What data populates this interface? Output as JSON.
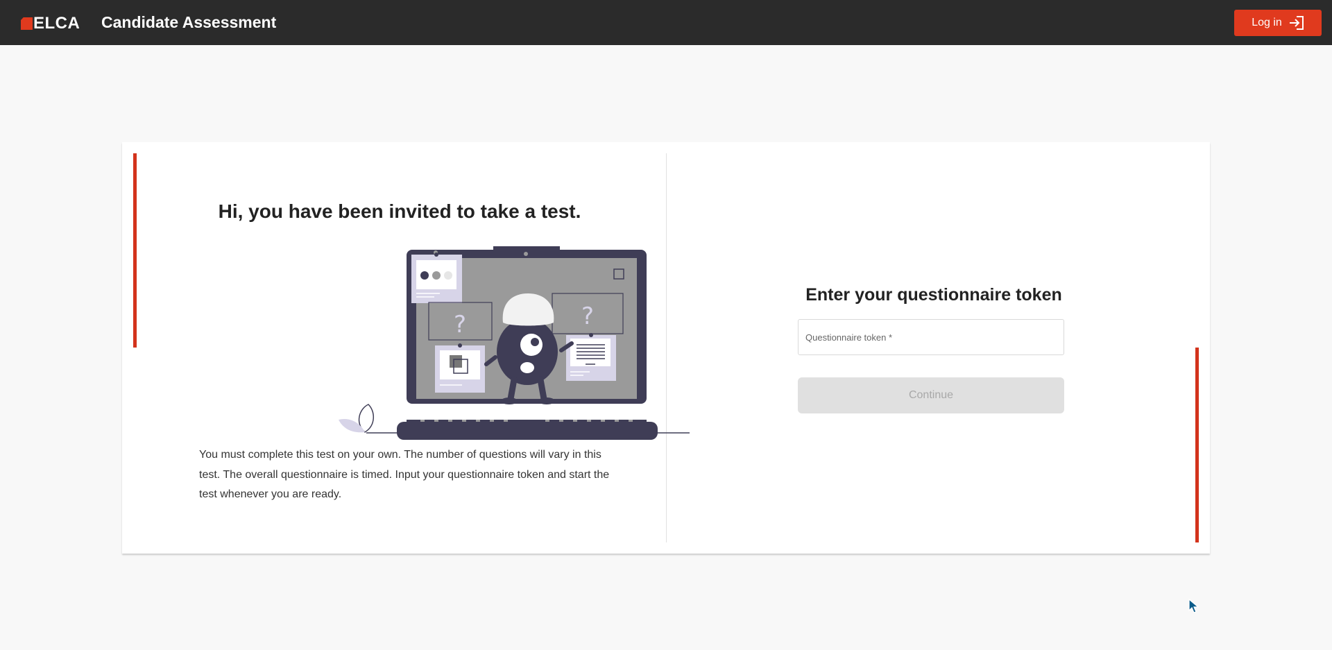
{
  "header": {
    "logo_text": "ELCA",
    "app_title": "Candidate Assessment",
    "login_label": "Log in",
    "bg_color": "#2b2b2b",
    "accent_color": "#e03a1e"
  },
  "welcome": {
    "title": "Hi, you have been invited to take a test.",
    "intro": "You must complete this test on your own. The number of questions will vary in this test. The overall questionnaire is timed. Input your questionnaire token and start the test whenever you are ready."
  },
  "token_form": {
    "title": "Enter your questionnaire token",
    "placeholder": "Questionnaire token *",
    "value": "",
    "continue_label": "Continue",
    "continue_disabled": true
  },
  "icons": {
    "login": "login-arrow-icon",
    "logo": "elca-logo-icon",
    "cursor": "mouse-cursor-icon"
  }
}
